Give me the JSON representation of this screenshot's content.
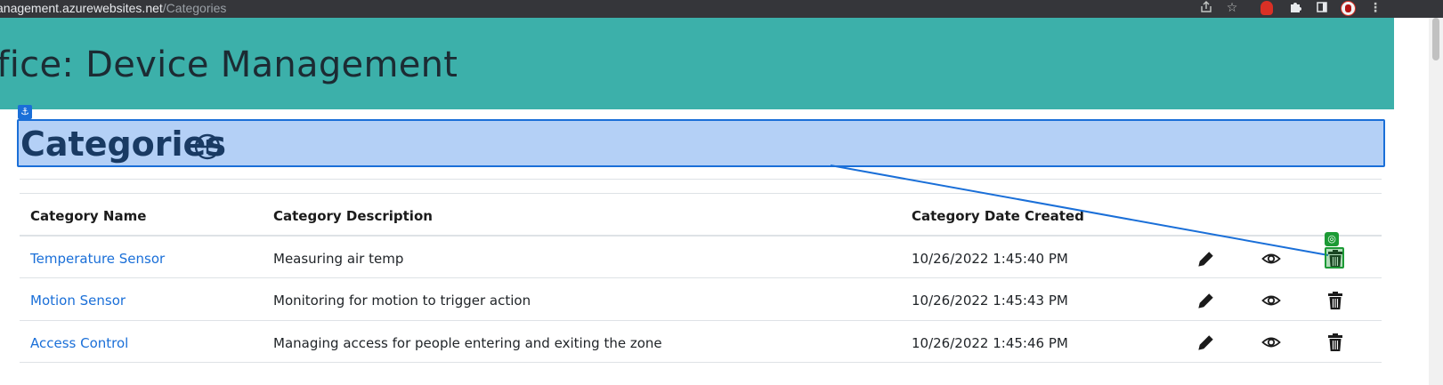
{
  "browser": {
    "url_host": "anagement.azurewebsites.net",
    "url_path": "/Categories"
  },
  "app": {
    "title": "ffice: Device Management"
  },
  "page": {
    "heading": "Categories"
  },
  "table": {
    "headers": {
      "name": "Category Name",
      "description": "Category Description",
      "date": "Category Date Created"
    },
    "rows": [
      {
        "name": "Temperature Sensor",
        "description": "Measuring air temp",
        "date": "10/26/2022 1:45:40 PM"
      },
      {
        "name": "Motion Sensor",
        "description": "Monitoring for motion to trigger action",
        "date": "10/26/2022 1:45:43 PM"
      },
      {
        "name": "Access Control",
        "description": "Managing access for people entering and exiting the zone",
        "date": "10/26/2022 1:45:46 PM"
      }
    ]
  },
  "icons": {
    "add": "plus-circle-icon",
    "edit": "pencil-icon",
    "view": "eye-icon",
    "delete": "trash-icon",
    "anchor": "anchor-icon",
    "target": "target-icon"
  },
  "colors": {
    "header_bg": "#3cb0aa",
    "highlight_bg": "#b4d0f6",
    "highlight_border": "#1a6fd8",
    "link": "#1a6fd8",
    "target": "#1c9a35"
  }
}
